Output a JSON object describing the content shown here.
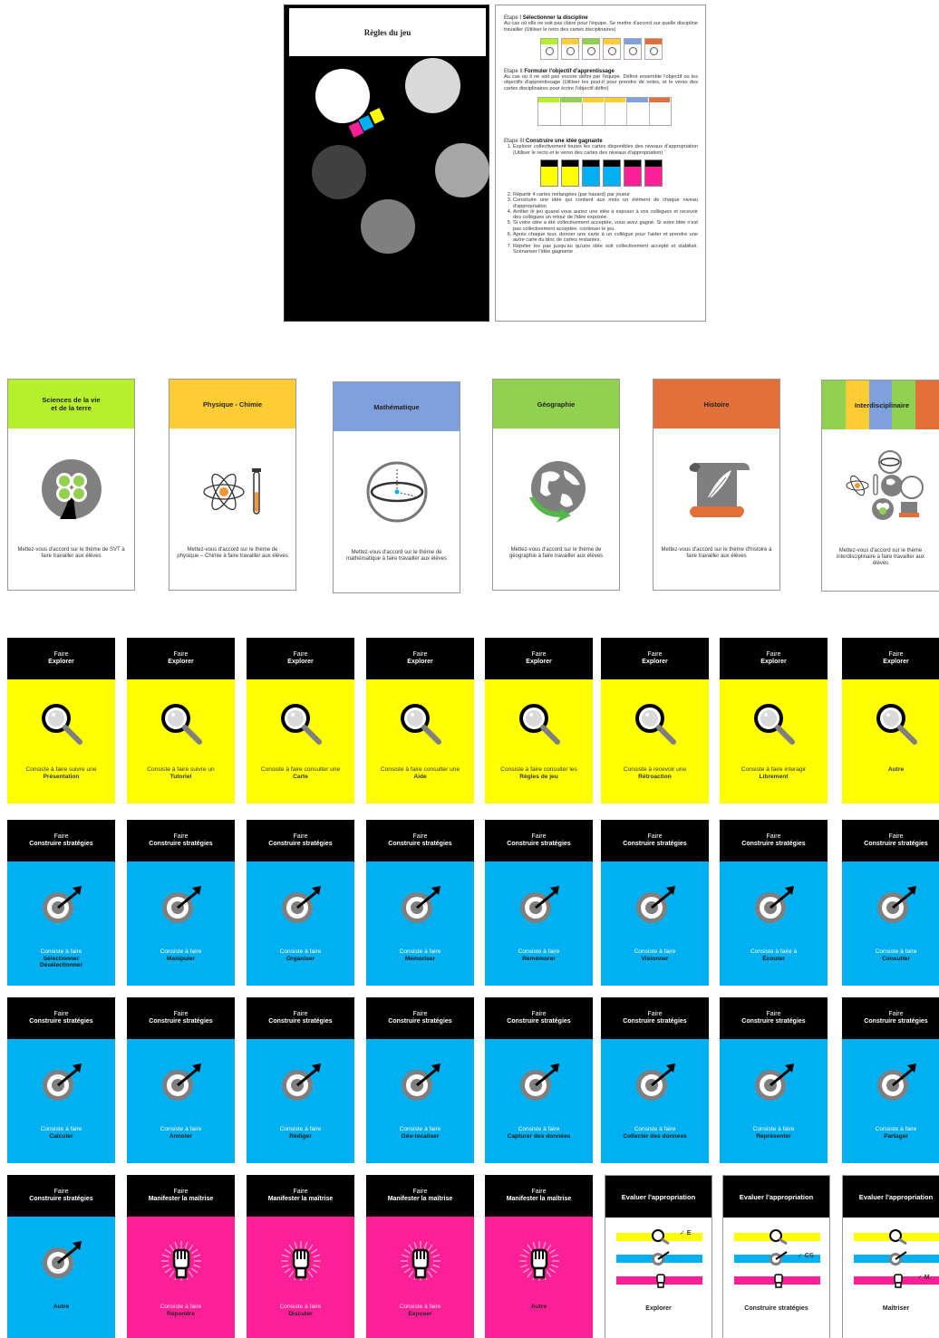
{
  "rules": {
    "title": "Règles du jeu",
    "step1_title": "Sélectionner la discipline",
    "step1_prefix": "Etape I",
    "step1_text": "Au cas où elle ne soit pas claire pour l'équipe. Se mettre d'accord sur quelle discipline travailler (Utiliser le retro des cartes disciplinaires)",
    "step2_prefix": "Etape II",
    "step2_title": "Formuler l'objectif d'apprentissage",
    "step2_text": "Au cas où il ne soit pas encore défini par l'équipe. Définir ensemble l'objectif ou les objectifs d'apprentissage (Utiliser les post-it pour prendre de notes, et le verso des cartes disciplinaires pour écrire l'objectif défini)",
    "step3_prefix": "Etape III",
    "step3_title": "Construire une idée gagnante",
    "step3_items": [
      "Explorer collectivement toutes les cartes disponibles des niveaux d'appropriation (Utiliser le recto et le verso des cartes des niveaux d'appropriation)",
      "Répartir 4 cartes mélangées (par hasard) par joueur",
      "Construire une idée qui contient aux mois un élément de chaque niveau d'appropriation",
      "Arrêter le jeu quand vous auriez une idée à exposer à vos collègues et recevoir des collègues un retour de l'idée exposée.",
      "Si votre idée a été collectivement acceptée, vous avez gagné. Si votre idée n'est pas collectivement acceptée, continuer le jeu.",
      "Après chaque tour, donner une carte à un collègue pour l'aider et prendre une autre carte du bloc de cartes restantes.",
      "Répéter les pas jusqu'au qu'une idée soit collectivement accepté et stabilisé. Scénariser l'idée gagnante"
    ]
  },
  "disciplines": [
    {
      "title": "Sciences de la vie\net de la terre",
      "text": "Mettez-vous d'accord sur le thème de SVT à faire travailler aux élèves",
      "color": "#b5f02a",
      "icon": "plant-icon"
    },
    {
      "title": "Physique - Chimie",
      "text": "Mettez-vous d'accord sur le thème de physique – Chimie à faire travailler aux élèves",
      "color": "#ffcc33",
      "icon": "atom-icon"
    },
    {
      "title": "Mathématique",
      "text": "Mettez-vous d'accord sur le thème de mathématique à faire travailler aux élèves",
      "color": "#7fa0dc",
      "icon": "geometry-icon"
    },
    {
      "title": "Géographie",
      "text": "Mettez-vous d'accord sur le thème de géographie à faire travailler aux élèves",
      "color": "#92d050",
      "icon": "globe-icon"
    },
    {
      "title": "Histoire",
      "text": "Mettez-vous d'accord sur le thème d'histoire à faire travailler aux élèves",
      "color": "#e2703a",
      "icon": "scroll-icon"
    },
    {
      "title": "Interdisciplinaire",
      "text": "Mettez-vous d'accord sur le thème interdisciplinaire à faire travailler aux élèves",
      "color": "#ffcc33",
      "icon": "interdisciplinary-icon"
    }
  ],
  "header_faire": "Faire",
  "explorer": {
    "label": "Explorer",
    "cards": [
      {
        "pre": "Consiste à faire suivre une",
        "bold": "Présentation"
      },
      {
        "pre": "Consiste à faire suivre un",
        "bold": "Tutoriel"
      },
      {
        "pre": "Consiste à faire consulter une",
        "bold": "Carte"
      },
      {
        "pre": "Consiste à faire consulter une",
        "bold": "Aide"
      },
      {
        "pre": "Consiste à faire consulter les",
        "bold": "Règles de jeu"
      },
      {
        "pre": "Consiste à recevoir une",
        "bold": "Rétroaction"
      },
      {
        "pre": "Consiste à faire interagir",
        "bold": "Librement"
      },
      {
        "pre": "",
        "bold": "Autre"
      }
    ]
  },
  "strategies": {
    "label": "Construire stratégies",
    "row1": [
      {
        "pre": "Consiste à faire",
        "bold": "Sélectionner\nDésélectionner"
      },
      {
        "pre": "Consiste à faire",
        "bold": "Manipuler"
      },
      {
        "pre": "Consiste à faire",
        "bold": "Organiser"
      },
      {
        "pre": "Consiste à faire",
        "bold": "Mémoriser"
      },
      {
        "pre": "Consiste à faire",
        "bold": "Remémorer"
      },
      {
        "pre": "Consiste à faire",
        "bold": "Visionner"
      },
      {
        "pre": "Consiste à faire à",
        "bold": "Écouter"
      },
      {
        "pre": "Consiste à faire",
        "bold": "Consulter"
      }
    ],
    "row2": [
      {
        "pre": "Consiste à faire",
        "bold": "Calculer"
      },
      {
        "pre": "Consiste à faire",
        "bold": "Annoter"
      },
      {
        "pre": "Consiste à faire",
        "bold": "Rédiger"
      },
      {
        "pre": "Consiste à faire",
        "bold": "Géo-localiser"
      },
      {
        "pre": "Consiste à faire",
        "bold": "Capturer des données"
      },
      {
        "pre": "Consiste à faire",
        "bold": "Collecter des données"
      },
      {
        "pre": "Consiste à faire",
        "bold": "Représenter"
      },
      {
        "pre": "Consiste à faire",
        "bold": "Partager"
      }
    ],
    "other": {
      "pre": "",
      "bold": "Autre"
    }
  },
  "maitrise": {
    "label": "Manifester la maîtrise",
    "cards": [
      {
        "pre": "Consiste à faire",
        "bold": "Répondre"
      },
      {
        "pre": "Consiste à faire",
        "bold": "Discuter"
      },
      {
        "pre": "Consiste à faire",
        "bold": "Exposer"
      },
      {
        "pre": "",
        "bold": "Autre"
      }
    ]
  },
  "evaluation": {
    "title": "Evaluer l'appropriation",
    "cards": [
      {
        "label": "Explorer",
        "mark": "✓ E"
      },
      {
        "label": "Construire stratégies",
        "mark": "✓ CS"
      },
      {
        "label": "Maîtriser",
        "mark": "✓ M"
      }
    ]
  },
  "colors": {
    "yellow": "#ffff00",
    "blue": "#00b0f0",
    "pink": "#ff1f97",
    "black": "#000000"
  }
}
